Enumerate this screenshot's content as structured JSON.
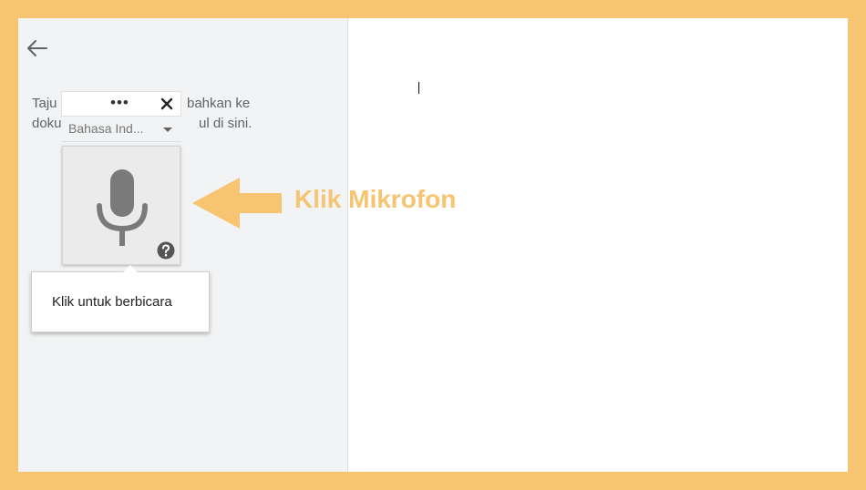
{
  "outline_panel": {
    "text_line_1": "Taju",
    "text_line_1_end": "bahkan ke",
    "text_line_2": "doku",
    "text_line_2_end": "ul di sini."
  },
  "voice_typing": {
    "menu_label": "•••",
    "language": "Bahasa Ind...",
    "tooltip": "Klik untuk berbicara",
    "icons": [
      "more-dots-icon",
      "close-icon",
      "chevron-down-icon",
      "microphone-icon",
      "help-icon"
    ]
  },
  "annotation": {
    "label": "Klik Mikrofon",
    "color": "#f7c471"
  },
  "colors": {
    "border_frame": "#f7c471",
    "panel_bg": "#f1f3f4",
    "mic_gray": "#7a7a7a"
  }
}
